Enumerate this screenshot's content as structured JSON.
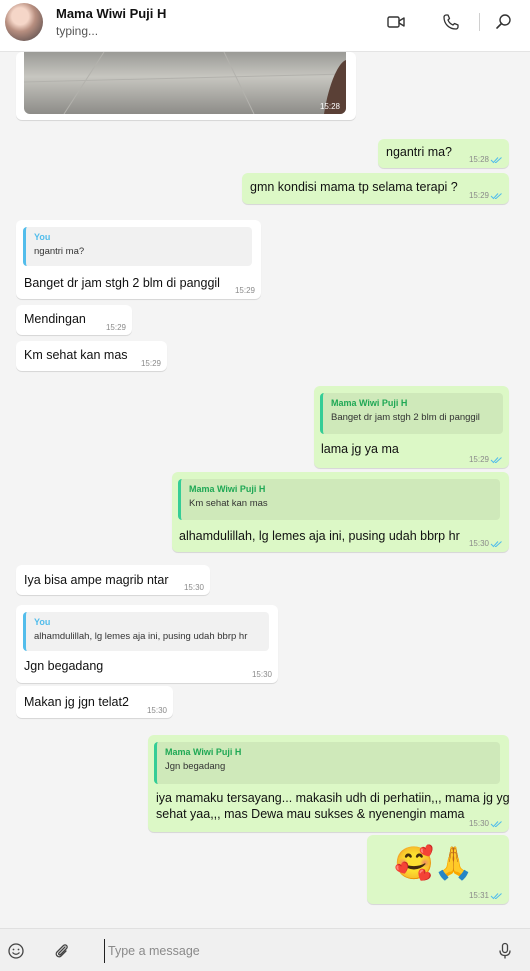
{
  "header": {
    "contact_name": "Mama Wiwi Puji H",
    "status": "typing...",
    "icons": [
      "video-call-icon",
      "voice-call-icon",
      "search-icon"
    ]
  },
  "media": {
    "time": "15:28"
  },
  "messages": [
    {
      "dir": "out",
      "text": "ngantri ma?",
      "time": "15:28",
      "read": true
    },
    {
      "dir": "out",
      "text": "gmn kondisi mama tp selama terapi ?",
      "time": "15:29",
      "read": true
    },
    {
      "dir": "in",
      "quote_name": "You",
      "quote_text": "ngantri ma?",
      "text": "Banget dr jam stgh 2 blm di panggil",
      "time": "15:29"
    },
    {
      "dir": "in",
      "text": "Mendingan",
      "time": "15:29"
    },
    {
      "dir": "in",
      "text": "Km sehat kan mas",
      "time": "15:29"
    },
    {
      "dir": "out",
      "quote_name": "Mama Wiwi Puji H",
      "quote_text": "Banget dr jam stgh 2 blm di panggil",
      "text": "lama jg ya ma",
      "time": "15:29",
      "read": true
    },
    {
      "dir": "out",
      "quote_name": "Mama Wiwi Puji H",
      "quote_text": "Km sehat kan mas",
      "text": "alhamdulillah, lg lemes aja ini, pusing udah bbrp hr",
      "time": "15:30",
      "read": true
    },
    {
      "dir": "in",
      "text": "Iya bisa ampe magrib ntar",
      "time": "15:30"
    },
    {
      "dir": "in",
      "quote_name": "You",
      "quote_text": "alhamdulillah, lg lemes aja ini, pusing udah bbrp hr",
      "text": "Jgn begadang",
      "time": "15:30"
    },
    {
      "dir": "in",
      "text": "Makan jg jgn telat2",
      "time": "15:30"
    },
    {
      "dir": "out",
      "quote_name": "Mama Wiwi Puji H",
      "quote_text": "Jgn begadang",
      "text_line1": "iya mamaku tersayang... makasih udh di perhatiin,,, mama jg yg",
      "text_line2": "sehat yaa,,, mas Dewa mau sukses & nyenengin mama",
      "time": "15:30",
      "read": true
    },
    {
      "dir": "out",
      "text": "🥰🙏",
      "time": "15:31",
      "read": true
    }
  ],
  "composer": {
    "placeholder": "Type a message",
    "icons": [
      "emoji-icon",
      "attach-icon",
      "microphone-icon"
    ]
  },
  "colors": {
    "incoming_bubble": "#ffffff",
    "outgoing_bubble": "#dcf8c6",
    "read_tick": "#53bdeb",
    "quote_name_green": "#1fa855"
  }
}
